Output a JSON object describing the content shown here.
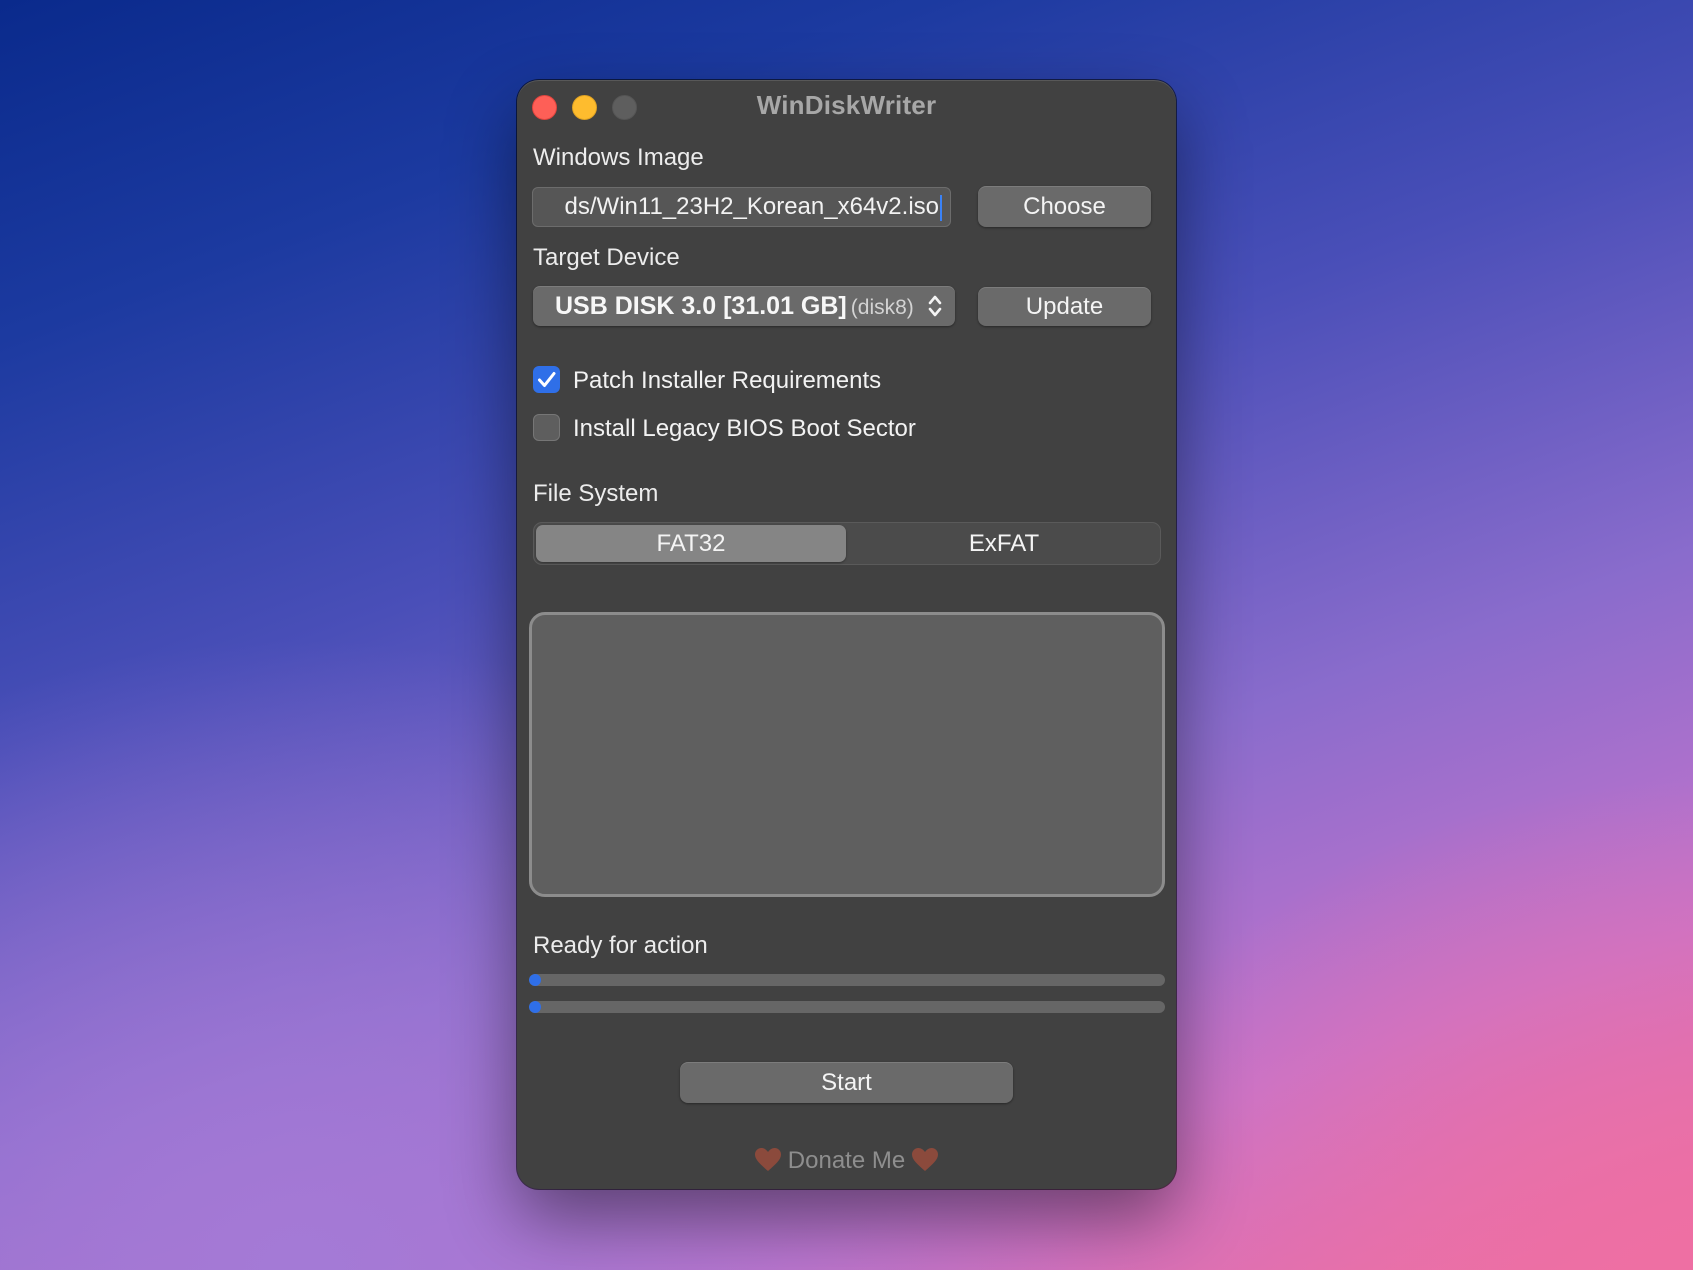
{
  "window": {
    "title": "WinDiskWriter"
  },
  "windows_image": {
    "label": "Windows Image",
    "path_value": "ds/Win11_23H2_Korean_x64v2.iso",
    "choose_label": "Choose"
  },
  "target_device": {
    "label": "Target Device",
    "selected_device": "USB DISK 3.0 [31.01 GB]",
    "selected_device_id": "(disk8)",
    "update_label": "Update"
  },
  "options": [
    {
      "label": "Patch Installer Requirements",
      "checked": true
    },
    {
      "label": "Install Legacy BIOS Boot Sector",
      "checked": false
    }
  ],
  "file_system": {
    "label": "File System",
    "segments": [
      "FAT32",
      "ExFAT"
    ],
    "selected": "FAT32"
  },
  "log": {
    "content": ""
  },
  "status": {
    "text": "Ready for action",
    "progress_primary": 0.0,
    "progress_secondary": 0.0
  },
  "actions": {
    "start_label": "Start",
    "donate_label": "Donate Me"
  },
  "colors": {
    "accent": "#2f6fe8",
    "window_bg": "#414141",
    "close": "#fe5f57",
    "minimize": "#febc2e",
    "heart": "#8b4a3c"
  }
}
